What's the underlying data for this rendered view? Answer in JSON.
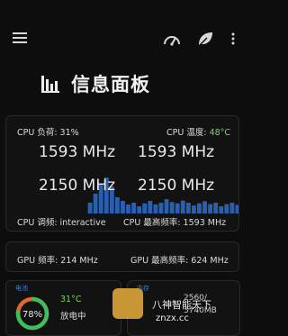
{
  "header": {
    "menu_icon": "hamburger-menu-icon",
    "action_icons": [
      "gauge-icon",
      "leaf-icon",
      "more-vert-icon"
    ]
  },
  "title": {
    "icon": "bar-chart-icon",
    "text": "信息面板"
  },
  "cpu": {
    "load_label": "CPU 负荷: 31%",
    "temp_label": "CPU 温度: ",
    "temp_value": "48°C",
    "freqs": [
      "1593 MHz",
      "1593 MHz",
      "2150 MHz",
      "2150 MHz"
    ],
    "governor_label": "CPU 调频: interactive",
    "max_freq_label": "CPU 最高频率: 1593 MHz",
    "load_history": [
      0.3,
      0.55,
      0.8,
      1.0,
      0.75,
      0.45,
      0.35,
      0.25,
      0.3,
      0.2,
      0.28,
      0.35,
      0.25,
      0.3,
      0.4,
      0.32,
      0.28,
      0.36,
      0.3,
      0.22,
      0.28,
      0.34,
      0.26,
      0.3,
      0.2,
      0.26,
      0.3,
      0.24
    ],
    "bar_color": "#2a5fb0"
  },
  "gpu": {
    "freq_label": "GPU 频率: 214 MHz",
    "max_freq_label": "GPU 最高频率: 624 MHz"
  },
  "battery": {
    "section_label": "电池",
    "level_text": "78%",
    "level": 0.78,
    "temp": "31°C",
    "state": "放电中"
  },
  "memory": {
    "section_label": "内存",
    "line1": "2560/",
    "line2": "3740MB"
  },
  "watermark": {
    "line1": "八神智能天下",
    "line2": "znzx.cc"
  },
  "colors": {
    "accent_blue": "#3d7fd6",
    "temp_green": "#7fd06a",
    "ring_green": "#3fbf5a",
    "ring_orange": "#e0672e"
  }
}
